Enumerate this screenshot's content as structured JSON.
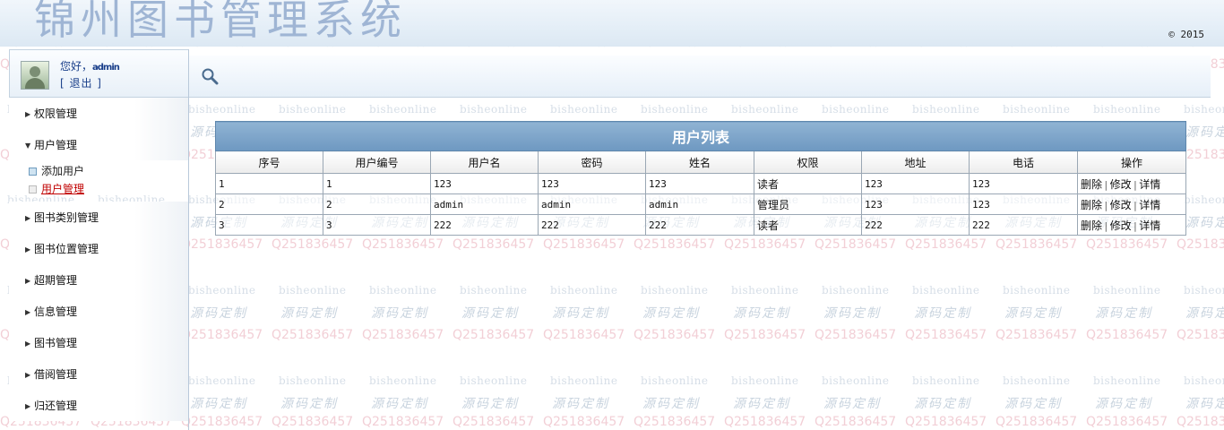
{
  "header": {
    "system_title": "锦州图书管理系统",
    "copyright": "© 2015"
  },
  "watermark": {
    "text_a": "bisheonline",
    "text_b": "源码定制",
    "text_c": "Q251836457"
  },
  "user": {
    "greeting": "您好，",
    "username": "admin",
    "logout": "[ 退出 ]"
  },
  "sidebar": {
    "items": [
      {
        "label": "权限管理"
      },
      {
        "label": "用户管理",
        "sub": [
          {
            "label": "添加用户"
          },
          {
            "label": "用户管理"
          }
        ]
      },
      {
        "label": "图书类别管理"
      },
      {
        "label": "图书位置管理"
      },
      {
        "label": "超期管理"
      },
      {
        "label": "信息管理"
      },
      {
        "label": "图书管理"
      },
      {
        "label": "借阅管理"
      },
      {
        "label": "归还管理"
      }
    ]
  },
  "table": {
    "caption": "用户列表",
    "columns": [
      "序号",
      "用户编号",
      "用户名",
      "密码",
      "姓名",
      "权限",
      "地址",
      "电话",
      "操作"
    ],
    "rows": [
      [
        "1",
        "1",
        "123",
        "123",
        "123",
        "读者",
        "123",
        "123"
      ],
      [
        "2",
        "2",
        "admin",
        "admin",
        "admin",
        "管理员",
        "123",
        "123"
      ],
      [
        "3",
        "3",
        "222",
        "222",
        "222",
        "读者",
        "222",
        "222"
      ]
    ],
    "actions": {
      "delete": "删除",
      "edit": "修改",
      "detail": "详情",
      "sep": "|"
    }
  },
  "colors": {
    "title": "#9fb5d4",
    "caption_bg": "#7aa2c8",
    "active_link": "#c00000",
    "greeting_text": "#1a3f8a"
  }
}
